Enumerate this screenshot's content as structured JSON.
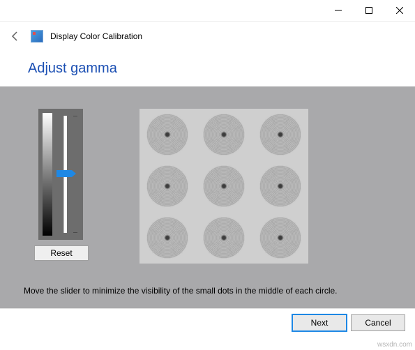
{
  "window": {
    "title": "Display Color Calibration"
  },
  "page": {
    "heading": "Adjust gamma",
    "instruction": "Move the slider to minimize the visibility of the small dots in the middle of each circle."
  },
  "slider": {
    "value": 50,
    "min": 0,
    "max": 100
  },
  "buttons": {
    "reset": "Reset",
    "next": "Next",
    "cancel": "Cancel"
  },
  "watermark": "wsxdn.com"
}
